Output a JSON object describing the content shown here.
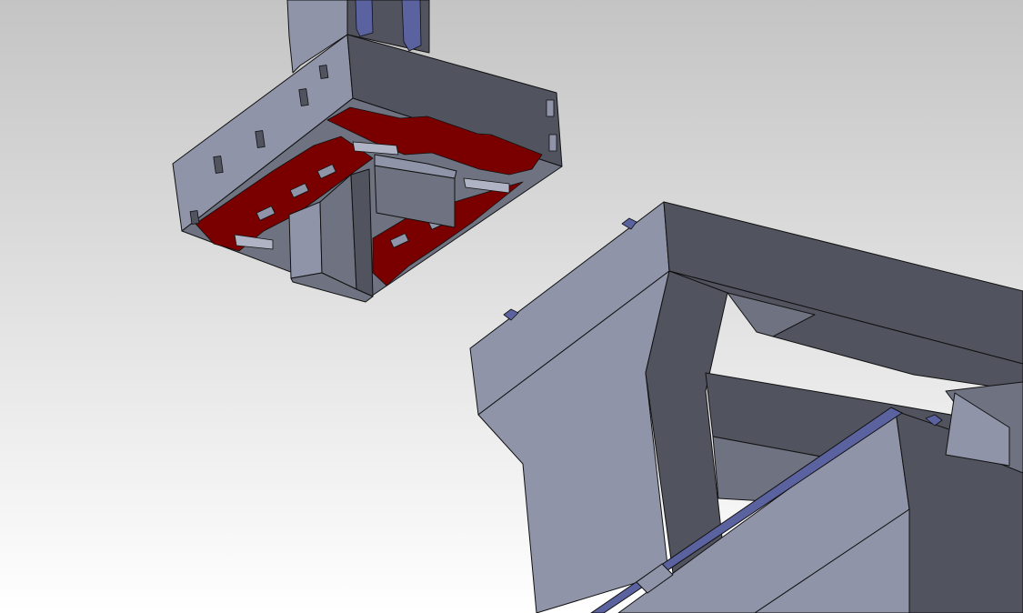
{
  "viewport": {
    "background_top": "#c4c4c4",
    "background_bottom": "#ffffff"
  },
  "scene": {
    "material_colors": {
      "light_face": "#9094a8",
      "mid_face": "#6f7280",
      "dark_face": "#51535f",
      "cutout_red": "#7a0000",
      "rail_blue": "#5b62a0",
      "bg": "#d9d9d9"
    },
    "parts": [
      {
        "name": "upper-mount-assembly"
      },
      {
        "name": "lower-frame-assembly"
      },
      {
        "name": "linear-rail"
      }
    ]
  }
}
